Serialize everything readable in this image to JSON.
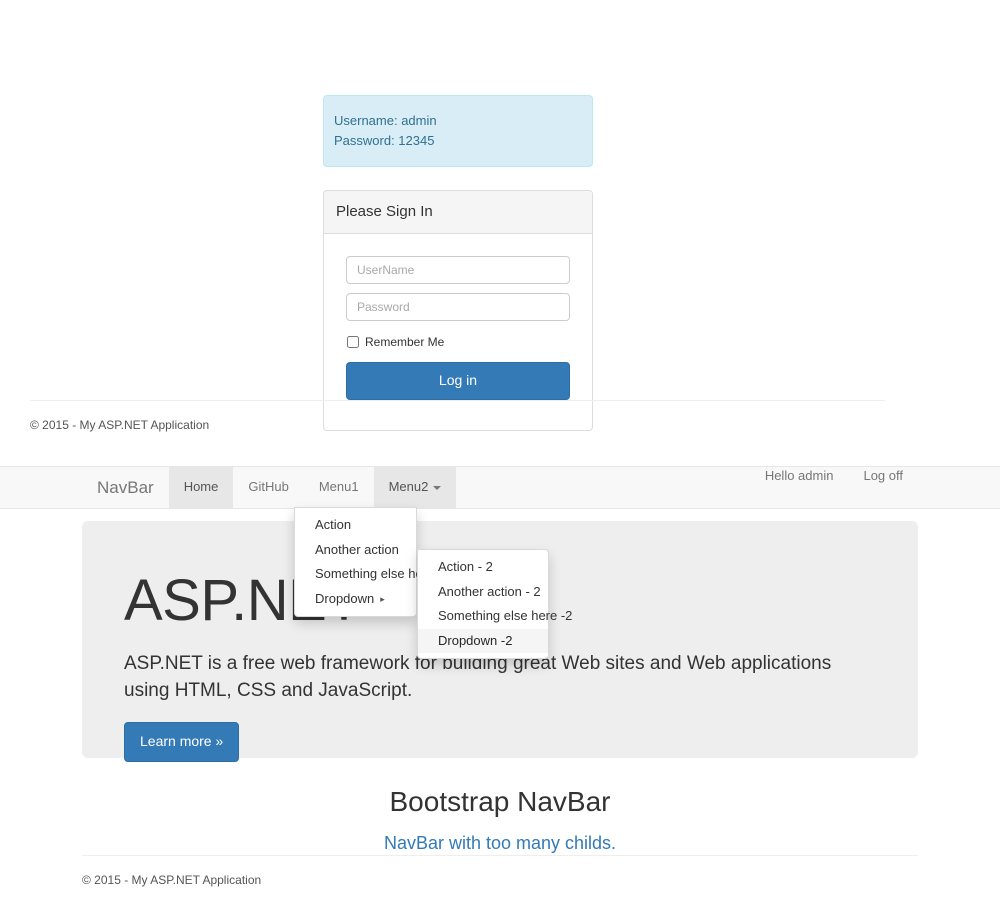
{
  "login": {
    "hint": {
      "username_line": "Username: admin",
      "password_line": "Password: 12345"
    },
    "panel_title": "Please Sign In",
    "username_placeholder": "UserName",
    "password_placeholder": "Password",
    "remember_label": "Remember Me",
    "submit_label": "Log in"
  },
  "footer": {
    "top_text": "© 2015 - My ASP.NET Application",
    "bottom_text": "© 2015 - My ASP.NET Application"
  },
  "navbar": {
    "brand": "NavBar",
    "items": [
      {
        "label": "Home",
        "state": "active"
      },
      {
        "label": "GitHub",
        "state": "normal"
      },
      {
        "label": "Menu1",
        "state": "normal"
      },
      {
        "label": "Menu2",
        "state": "open",
        "caret": "caret-down-icon"
      }
    ],
    "right_items": [
      {
        "label": "Hello admin"
      },
      {
        "label": "Log off"
      }
    ]
  },
  "menu2_dropdown": {
    "items": [
      {
        "label": "Action",
        "state": "normal"
      },
      {
        "label": "Another action",
        "state": "normal"
      },
      {
        "label": "Something else here",
        "state": "normal"
      },
      {
        "label": "Dropdown",
        "state": "normal",
        "submenu_caret": "▸"
      }
    ]
  },
  "submenu_dropdown": {
    "items": [
      {
        "label": "Action - 2",
        "state": "normal"
      },
      {
        "label": "Another action - 2",
        "state": "normal"
      },
      {
        "label": "Something else here -2",
        "state": "normal"
      },
      {
        "label": "Dropdown -2",
        "state": "highlighted"
      }
    ]
  },
  "jumbotron": {
    "title": "ASP.NET",
    "lead": "ASP.NET is a free web framework for building great Web sites and Web applications using HTML, CSS and JavaScript.",
    "button_label": "Learn more »"
  },
  "headline": {
    "title": "Bootstrap NavBar",
    "subtitle": "NavBar with too many childs."
  },
  "colors": {
    "primary": "#337ab7",
    "info_bg": "#d9edf7",
    "info_border": "#bce8f1",
    "info_text": "#31708f",
    "navbar_bg": "#f8f8f8",
    "navbar_active": "#e7e7e7",
    "jumbotron_bg": "#eeeeee",
    "panel_heading_bg": "#f5f5f5"
  }
}
